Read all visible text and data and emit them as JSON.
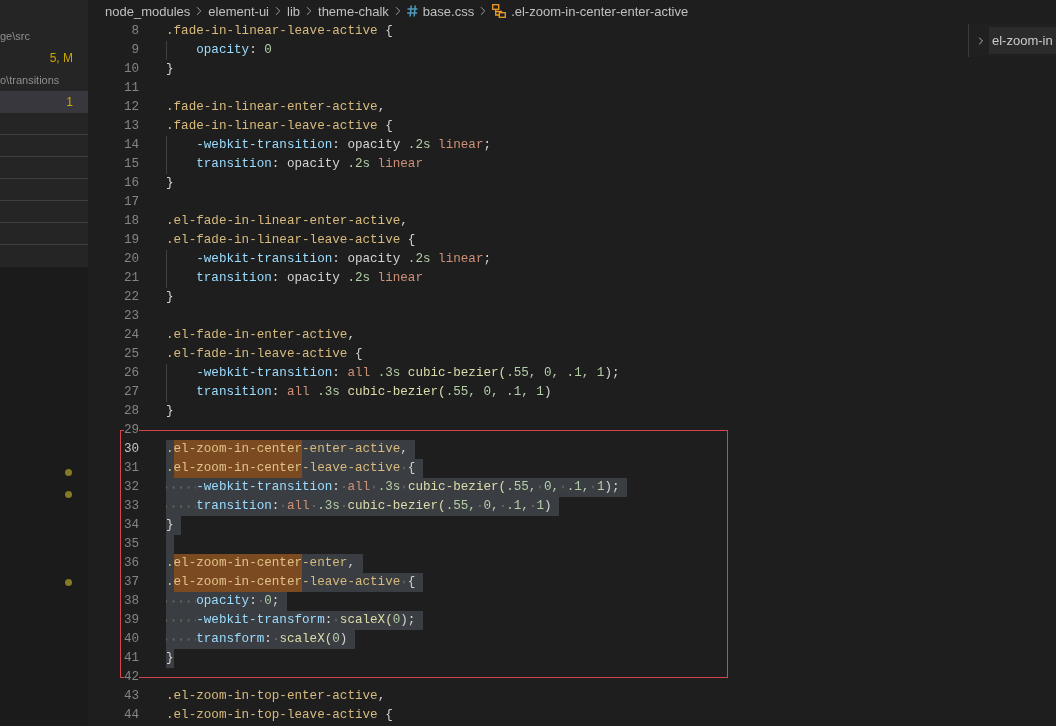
{
  "sidebar": {
    "rows": [
      {
        "kind": "entry",
        "description": "ge\\src",
        "selected": false
      },
      {
        "kind": "entry",
        "badge": "5, M",
        "selected": false
      },
      {
        "kind": "entry",
        "description": "o\\transitions",
        "selected": false
      },
      {
        "kind": "entry",
        "badge": "1",
        "selected": true
      },
      {
        "kind": "separator"
      },
      {
        "kind": "separator"
      },
      {
        "kind": "separator"
      },
      {
        "kind": "separator"
      },
      {
        "kind": "separator"
      },
      {
        "kind": "separator"
      }
    ],
    "markers": [
      {
        "marked": true
      },
      {
        "marked": true
      },
      {
        "marked": false
      },
      {
        "marked": false
      },
      {
        "marked": false
      },
      {
        "marked": true
      }
    ]
  },
  "breadcrumbs": [
    {
      "kind": "folder",
      "label": "node_modules"
    },
    {
      "kind": "folder",
      "label": "element-ui"
    },
    {
      "kind": "folder",
      "label": "lib"
    },
    {
      "kind": "folder",
      "label": "theme-chalk"
    },
    {
      "kind": "file",
      "label": "base.css"
    },
    {
      "kind": "symbol",
      "label": ".el-zoom-in-center-enter-active"
    }
  ],
  "editor": {
    "lines": [
      {
        "number": "8",
        "kind": "rule",
        "selected": false,
        "current": false,
        "tokens": [
          {
            "text": ".fade-in-linear-leave-active",
            "kind": "selector"
          },
          {
            "text": " {",
            "kind": "plain"
          }
        ]
      },
      {
        "number": "9",
        "kind": "declaration",
        "selected": false,
        "current": false,
        "tokens": [
          {
            "text": "opacity",
            "kind": "property"
          },
          {
            "text": ": ",
            "kind": "plain"
          },
          {
            "text": "0",
            "kind": "number"
          }
        ]
      },
      {
        "number": "10",
        "kind": "rule",
        "selected": false,
        "current": false,
        "tokens": [
          {
            "text": "}",
            "kind": "plain"
          }
        ]
      },
      {
        "number": "11",
        "kind": "blank",
        "selected": false,
        "current": false
      },
      {
        "number": "12",
        "kind": "rule",
        "selected": false,
        "current": false,
        "tokens": [
          {
            "text": ".fade-in-linear-enter-active",
            "kind": "selector"
          },
          {
            "text": ",",
            "kind": "plain"
          }
        ]
      },
      {
        "number": "13",
        "kind": "rule",
        "selected": false,
        "current": false,
        "tokens": [
          {
            "text": ".fade-in-linear-leave-active",
            "kind": "selector"
          },
          {
            "text": " {",
            "kind": "plain"
          }
        ]
      },
      {
        "number": "14",
        "kind": "declaration",
        "selected": false,
        "current": false,
        "tokens": [
          {
            "text": "-webkit-transition",
            "kind": "property"
          },
          {
            "text": ": opacity ",
            "kind": "plain"
          },
          {
            "text": ".2s",
            "kind": "number"
          },
          {
            "text": " linear",
            "kind": "keyword"
          },
          {
            "text": ";",
            "kind": "plain"
          }
        ]
      },
      {
        "number": "15",
        "kind": "declaration",
        "selected": false,
        "current": false,
        "tokens": [
          {
            "text": "transition",
            "kind": "property"
          },
          {
            "text": ": opacity ",
            "kind": "plain"
          },
          {
            "text": ".2s",
            "kind": "number"
          },
          {
            "text": " linear",
            "kind": "keyword"
          }
        ]
      },
      {
        "number": "16",
        "kind": "rule",
        "selected": false,
        "current": false,
        "tokens": [
          {
            "text": "}",
            "kind": "plain"
          }
        ]
      },
      {
        "number": "17",
        "kind": "blank",
        "selected": false,
        "current": false
      },
      {
        "number": "18",
        "kind": "rule",
        "selected": false,
        "current": false,
        "tokens": [
          {
            "text": ".el-fade-in-linear-enter-active",
            "kind": "selector"
          },
          {
            "text": ",",
            "kind": "plain"
          }
        ]
      },
      {
        "number": "19",
        "kind": "rule",
        "selected": false,
        "current": false,
        "tokens": [
          {
            "text": ".el-fade-in-linear-leave-active",
            "kind": "selector"
          },
          {
            "text": " {",
            "kind": "plain"
          }
        ]
      },
      {
        "number": "20",
        "kind": "declaration",
        "selected": false,
        "current": false,
        "tokens": [
          {
            "text": "-webkit-transition",
            "kind": "property"
          },
          {
            "text": ": opacity ",
            "kind": "plain"
          },
          {
            "text": ".2s",
            "kind": "number"
          },
          {
            "text": " linear",
            "kind": "keyword"
          },
          {
            "text": ";",
            "kind": "plain"
          }
        ]
      },
      {
        "number": "21",
        "kind": "declaration",
        "selected": false,
        "current": false,
        "tokens": [
          {
            "text": "transition",
            "kind": "property"
          },
          {
            "text": ": opacity ",
            "kind": "plain"
          },
          {
            "text": ".2s",
            "kind": "number"
          },
          {
            "text": " linear",
            "kind": "keyword"
          }
        ]
      },
      {
        "number": "22",
        "kind": "rule",
        "selected": false,
        "current": false,
        "tokens": [
          {
            "text": "}",
            "kind": "plain"
          }
        ]
      },
      {
        "number": "23",
        "kind": "blank",
        "selected": false,
        "current": false
      },
      {
        "number": "24",
        "kind": "rule",
        "selected": false,
        "current": false,
        "tokens": [
          {
            "text": ".el-fade-in-enter-active",
            "kind": "selector"
          },
          {
            "text": ",",
            "kind": "plain"
          }
        ]
      },
      {
        "number": "25",
        "kind": "rule",
        "selected": false,
        "current": false,
        "tokens": [
          {
            "text": ".el-fade-in-leave-active",
            "kind": "selector"
          },
          {
            "text": " {",
            "kind": "plain"
          }
        ]
      },
      {
        "number": "26",
        "kind": "declaration",
        "selected": false,
        "current": false,
        "tokens": [
          {
            "text": "-webkit-transition",
            "kind": "property"
          },
          {
            "text": ": ",
            "kind": "plain"
          },
          {
            "text": "all",
            "kind": "keyword"
          },
          {
            "text": " .3s",
            "kind": "number"
          },
          {
            "text": " cubic-bezier(",
            "kind": "function"
          },
          {
            "text": ".55, 0, .1, 1",
            "kind": "number"
          },
          {
            "text": ");",
            "kind": "plain"
          }
        ]
      },
      {
        "number": "27",
        "kind": "declaration",
        "selected": false,
        "current": false,
        "tokens": [
          {
            "text": "transition",
            "kind": "property"
          },
          {
            "text": ": ",
            "kind": "plain"
          },
          {
            "text": "all",
            "kind": "keyword"
          },
          {
            "text": " .3s",
            "kind": "number"
          },
          {
            "text": " cubic-bezier(",
            "kind": "function"
          },
          {
            "text": ".55, 0, .1, 1",
            "kind": "number"
          },
          {
            "text": ")",
            "kind": "plain"
          }
        ]
      },
      {
        "number": "28",
        "kind": "rule",
        "selected": false,
        "current": false,
        "tokens": [
          {
            "text": "}",
            "kind": "plain"
          }
        ]
      }
    ],
    "annotation": {
      "kind": "frame",
      "lines": [
        {
          "number": "29",
          "kind": "blank",
          "selected": false,
          "current": false
        },
        {
          "number": "30",
          "kind": "rule",
          "selected": true,
          "current": true,
          "tokens": [
            {
              "text": ".",
              "kind": "selector"
            },
            {
              "text": "el-zoom-in-center",
              "kind": "selector_match"
            },
            {
              "text": "-enter-active",
              "kind": "selector"
            },
            {
              "text": ",",
              "kind": "plain"
            }
          ]
        },
        {
          "number": "31",
          "kind": "rule",
          "selected": true,
          "current": false,
          "tokens": [
            {
              "text": ".",
              "kind": "selector"
            },
            {
              "text": "el-zoom-in-center",
              "kind": "selector_match"
            },
            {
              "text": "-leave-active",
              "kind": "selector"
            },
            {
              "text": " {",
              "kind": "plain"
            }
          ]
        },
        {
          "number": "32",
          "kind": "declaration",
          "selected": true,
          "current": false,
          "tokens": [
            {
              "text": "-webkit-transition",
              "kind": "property"
            },
            {
              "text": ": ",
              "kind": "plain"
            },
            {
              "text": "all",
              "kind": "keyword"
            },
            {
              "text": " .3s",
              "kind": "number"
            },
            {
              "text": " cubic-bezier(",
              "kind": "function"
            },
            {
              "text": ".55, 0, .1, 1",
              "kind": "number"
            },
            {
              "text": ");",
              "kind": "plain"
            }
          ]
        },
        {
          "number": "33",
          "kind": "declaration",
          "selected": true,
          "current": false,
          "tokens": [
            {
              "text": "transition",
              "kind": "property"
            },
            {
              "text": ": ",
              "kind": "plain"
            },
            {
              "text": "all",
              "kind": "keyword"
            },
            {
              "text": " .3s",
              "kind": "number"
            },
            {
              "text": " cubic-bezier(",
              "kind": "function"
            },
            {
              "text": ".55, 0, .1, 1",
              "kind": "number"
            },
            {
              "text": ")",
              "kind": "plain"
            }
          ]
        },
        {
          "number": "34",
          "kind": "rule",
          "selected": true,
          "current": false,
          "tokens": [
            {
              "text": "}",
              "kind": "plain"
            }
          ]
        },
        {
          "number": "35",
          "kind": "blank",
          "selected": true,
          "current": false
        },
        {
          "number": "36",
          "kind": "rule",
          "selected": true,
          "current": false,
          "tokens": [
            {
              "text": ".",
              "kind": "selector"
            },
            {
              "text": "el-zoom-in-center",
              "kind": "selector_match"
            },
            {
              "text": "-enter",
              "kind": "selector"
            },
            {
              "text": ",",
              "kind": "plain"
            }
          ]
        },
        {
          "number": "37",
          "kind": "rule",
          "selected": true,
          "current": false,
          "tokens": [
            {
              "text": ".",
              "kind": "selector"
            },
            {
              "text": "el-zoom-in-center",
              "kind": "selector_match"
            },
            {
              "text": "-leave-active",
              "kind": "selector"
            },
            {
              "text": " {",
              "kind": "plain"
            }
          ]
        },
        {
          "number": "38",
          "kind": "declaration",
          "selected": true,
          "current": false,
          "tokens": [
            {
              "text": "opacity",
              "kind": "property"
            },
            {
              "text": ": ",
              "kind": "plain"
            },
            {
              "text": "0",
              "kind": "number"
            },
            {
              "text": ";",
              "kind": "plain"
            }
          ]
        },
        {
          "number": "39",
          "kind": "declaration",
          "selected": true,
          "current": false,
          "tokens": [
            {
              "text": "-webkit-transform",
              "kind": "property"
            },
            {
              "text": ": ",
              "kind": "plain"
            },
            {
              "text": "scaleX(",
              "kind": "function"
            },
            {
              "text": "0",
              "kind": "number"
            },
            {
              "text": ");",
              "kind": "plain"
            }
          ]
        },
        {
          "number": "40",
          "kind": "declaration",
          "selected": true,
          "current": false,
          "tokens": [
            {
              "text": "transform",
              "kind": "property"
            },
            {
              "text": ": ",
              "kind": "plain"
            },
            {
              "text": "scaleX(",
              "kind": "function"
            },
            {
              "text": "0",
              "kind": "number"
            },
            {
              "text": ")",
              "kind": "plain"
            }
          ]
        },
        {
          "number": "41",
          "kind": "rule",
          "selected": true,
          "current": false,
          "tokens": [
            {
              "text": "}",
              "kind": "plain"
            }
          ]
        },
        {
          "number": "42",
          "kind": "blank",
          "selected": false,
          "current": false
        }
      ]
    },
    "lines_below": [
      {
        "number": "43",
        "kind": "rule",
        "selected": false,
        "current": false,
        "tokens": [
          {
            "text": ".el-zoom-in-top-enter-active",
            "kind": "selector"
          },
          {
            "text": ",",
            "kind": "plain"
          }
        ]
      },
      {
        "number": "44",
        "kind": "rule",
        "selected": false,
        "current": false,
        "tokens": [
          {
            "text": ".el-zoom-in-top-leave-active",
            "kind": "selector"
          },
          {
            "text": " {",
            "kind": "plain"
          }
        ]
      }
    ]
  },
  "outline": {
    "label": "el-zoom-in",
    "expanded": false
  }
}
